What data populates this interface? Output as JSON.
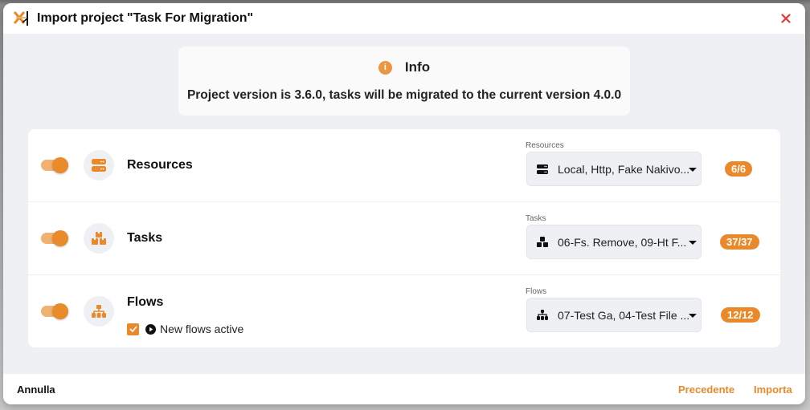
{
  "dialog": {
    "title": "Import project \"Task For Migration\"",
    "logo_icon": "app-logo-icon",
    "close_icon": "close-icon",
    "colors": {
      "accent": "#e9892a",
      "close": "#e53935",
      "background": "#eef0f3"
    }
  },
  "info": {
    "icon": "info-icon",
    "icon_glyph": "i",
    "title": "Info",
    "message": "Project version is 3.6.0, tasks will be migrated to the current version 4.0.0"
  },
  "sections": [
    {
      "label": "Resources",
      "enabled": true,
      "icon": "server-icon",
      "select_label": "Resources",
      "select_value": "Local, Http, Fake Nakivo...",
      "count": "6/6"
    },
    {
      "label": "Tasks",
      "enabled": true,
      "icon": "boxes-icon",
      "select_label": "Tasks",
      "select_value": "06-Fs. Remove, 09-Ht F...",
      "count": "37/37"
    },
    {
      "label": "Flows",
      "enabled": true,
      "icon": "sitemap-icon",
      "select_label": "Flows",
      "select_value": "07-Test Ga, 04-Test File ...",
      "count": "12/12",
      "option": {
        "checked": true,
        "icon": "play-circle-icon",
        "label": "New flows active"
      }
    }
  ],
  "footer": {
    "cancel_label": "Annulla",
    "previous_label": "Precedente",
    "import_label": "Importa"
  }
}
